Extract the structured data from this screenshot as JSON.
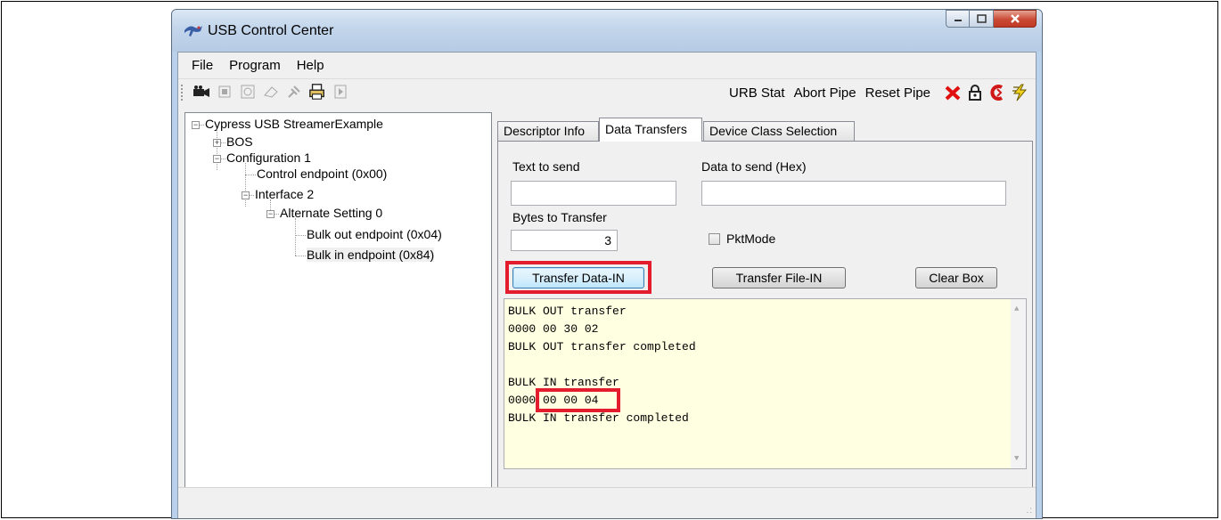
{
  "window": {
    "title": "USB Control Center"
  },
  "menu": {
    "items": [
      "File",
      "Program",
      "Help"
    ]
  },
  "toolbar": {
    "left_icons": [
      "camera-icon",
      "stop-icon",
      "timer-icon",
      "clear-icon",
      "tools-icon",
      "printer-icon",
      "play-icon"
    ],
    "urb_stat": "URB Stat",
    "abort_pipe": "Abort Pipe",
    "reset_pipe": "Reset Pipe",
    "right_icons": [
      "red-x-icon",
      "lock-icon",
      "cypress-logo-icon",
      "lightning-icon"
    ]
  },
  "tree": {
    "root": "Cypress USB StreamerExample",
    "bos": "BOS",
    "configuration": "Configuration 1",
    "control_endpoint": "Control endpoint (0x00)",
    "interface": "Interface 2",
    "alt_setting": "Alternate Setting 0",
    "bulk_out": "Bulk out endpoint (0x04)",
    "bulk_in": "Bulk in endpoint (0x84)"
  },
  "tabs": {
    "descriptor_info": "Descriptor Info",
    "data_transfers": "Data Transfers",
    "device_class": "Device Class Selection"
  },
  "data_transfers": {
    "text_to_send_label": "Text to send",
    "text_to_send_value": "",
    "data_to_send_label": "Data to send (Hex)",
    "data_to_send_value": "",
    "bytes_to_transfer_label": "Bytes to Transfer",
    "bytes_to_transfer_value": "3",
    "pktmode_label": "PktMode",
    "pktmode_checked": false,
    "transfer_data_in": "Transfer Data-IN",
    "transfer_file_in": "Transfer File-IN",
    "clear_box": "Clear Box",
    "output_lines": [
      "BULK OUT transfer",
      "0000 00 30 02",
      "BULK OUT transfer completed",
      "",
      "BULK IN transfer",
      "0000 00 00 04",
      "BULK IN transfer completed"
    ]
  },
  "colors": {
    "highlight_red": "#e31d2d",
    "output_background": "#ffffe1"
  }
}
